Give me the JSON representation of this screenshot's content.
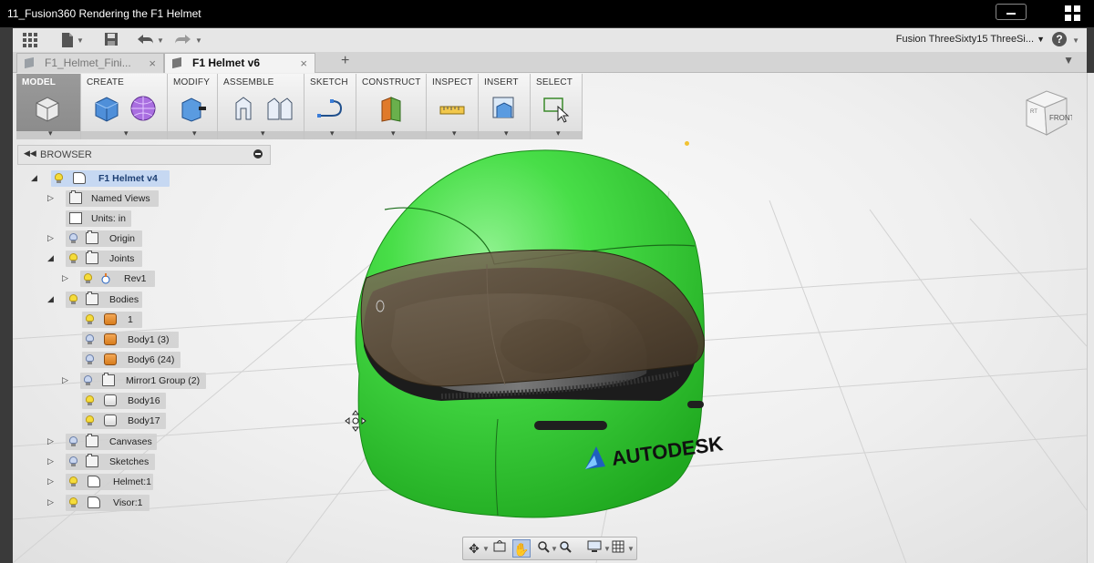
{
  "window": {
    "title": "11_Fusion360 Rendering the F1 Helmet"
  },
  "app_bar": {
    "doc_name": "Fusion ThreeSixty15 ThreeSi...",
    "doc_caret": "▼",
    "help_label": "?"
  },
  "tabs": [
    {
      "label": "F1_Helmet_Fini...",
      "close": "×",
      "active": false
    },
    {
      "label": "F1 Helmet v6",
      "close": "×",
      "active": true
    }
  ],
  "tab_new_label": "+",
  "ribbon": {
    "model": "MODEL",
    "create": "CREATE",
    "modify": "MODIFY",
    "assemble": "ASSEMBLE",
    "sketch": "SKETCH",
    "construct": "CONSTRUCT",
    "inspect": "INSPECT",
    "insert": "INSERT",
    "select": "SELECT"
  },
  "browser": {
    "title": "BROWSER",
    "root": "F1 Helmet v4",
    "nodes": {
      "named_views": "Named Views",
      "units": "Units: in",
      "origin": "Origin",
      "joints": "Joints",
      "rev1": "Rev1",
      "bodies": "Bodies",
      "body_1": "1",
      "body1": "Body1 (3)",
      "body6": "Body6 (24)",
      "mirror1": "Mirror1 Group (2)",
      "body16": "Body16",
      "body17": "Body17",
      "canvases": "Canvases",
      "sketches": "Sketches",
      "helmet": "Helmet:1",
      "visor": "Visor:1"
    }
  },
  "viewcube": {
    "front": "FRONT",
    "side": "RT"
  },
  "model": {
    "brand_text": "AUTODESK",
    "helmet_color": "#3fd84b",
    "visor_tint": "#5a4a36"
  },
  "colors": {
    "title_bar": "#000000",
    "selection": "#c6d8f2",
    "accent": "#1d6fd1"
  }
}
